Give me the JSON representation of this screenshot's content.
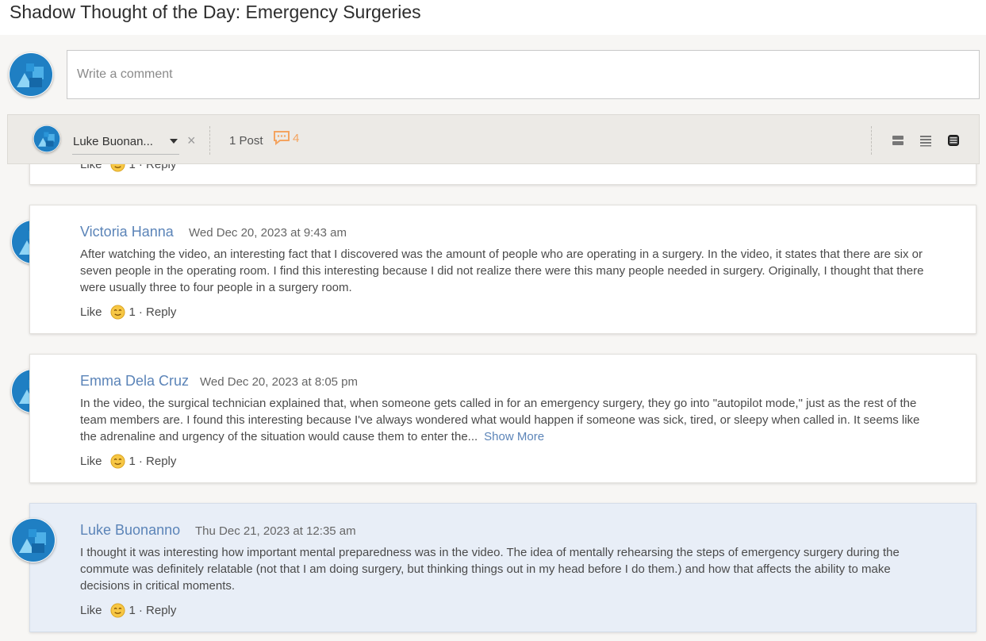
{
  "page": {
    "title": "Shadow Thought of the Day: Emergency Surgeries"
  },
  "composer": {
    "placeholder": "Write a comment"
  },
  "filter": {
    "user_name": "Luke Buonan...",
    "post_count": "1 Post",
    "comment_count": "4",
    "accent_color": "#f4a460"
  },
  "partial_card": {
    "like": "Like",
    "reaction_count": "1",
    "reply": "· Reply"
  },
  "comments": [
    {
      "author": "Victoria Hanna",
      "timestamp": "Wed Dec 20, 2023 at 9:43 am",
      "text": "After watching the video, an interesting fact that I discovered was the amount of people who are operating in a surgery. In the video, it states that there are six or seven people in the operating room. I find this interesting because I did not realize there were this many people needed in surgery. Originally, I thought that there were usually three to four people in a surgery room.",
      "like": "Like",
      "reaction_count": "1",
      "reply": "· Reply"
    },
    {
      "author": "Emma Dela Cruz",
      "timestamp": "Wed Dec 20, 2023 at 8:05 pm",
      "text": "In the video, the surgical technician explained that, when someone gets called in for an emergency surgery, they go into \"autopilot mode,\" just as the rest of the team members are. I found this interesting because I've always wondered what would happen if someone was sick, tired, or sleepy when called in. It seems like the adrenaline and urgency of the situation would cause them to enter the...",
      "show_more": "Show More",
      "like": "Like",
      "reaction_count": "1",
      "reply": "· Reply"
    },
    {
      "author": "Luke Buonanno",
      "timestamp": "Thu Dec 21, 2023 at 12:35 am",
      "text": "I thought it was interesting how important mental preparedness was in the video. The idea of mentally rehearsing the steps of emergency surgery during the commute was definitely relatable (not that I am doing surgery, but thinking things out in my head before I do them.) and how that affects the ability to make decisions in critical moments.",
      "like": "Like",
      "reaction_count": "1",
      "reply": "· Reply"
    }
  ],
  "icons": {
    "avatar": "avatar-icon",
    "comment": "speech-bubble-icon",
    "smiley": "smiley-reaction-icon",
    "views": [
      "expanded-view-icon",
      "list-view-icon",
      "compact-view-icon"
    ]
  }
}
